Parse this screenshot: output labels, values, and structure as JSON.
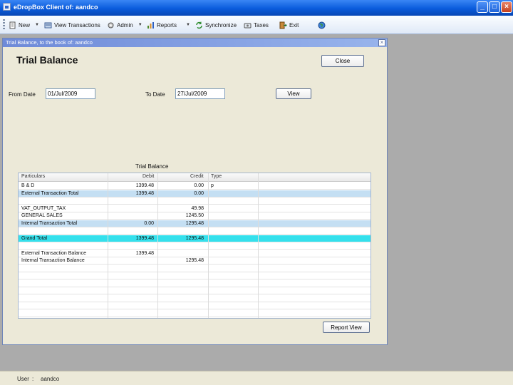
{
  "app": {
    "title": "eDropBox Client of: aandco",
    "minimize": "_",
    "maximize": "□",
    "close": "×"
  },
  "toolbar": {
    "items": [
      {
        "label": "New",
        "icon": "new-icon"
      },
      {
        "label": "View Transactions",
        "icon": "view-transactions-icon"
      },
      {
        "label": "Admin",
        "icon": "admin-icon"
      },
      {
        "label": "Reports",
        "icon": "reports-icon"
      },
      {
        "label": "Synchronize",
        "icon": "synchronize-icon"
      },
      {
        "label": "Taxes",
        "icon": "taxes-icon"
      },
      {
        "label": "Exit",
        "icon": "exit-icon"
      }
    ],
    "dropdown_glyph": "▼"
  },
  "window": {
    "title": "Trial Balance, to the book of: aandco",
    "close_glyph": "×"
  },
  "page": {
    "title": "Trial Balance",
    "close_button": "Close",
    "from_label": "From Date",
    "from_value": "01/Jul/2009",
    "to_label": "To Date",
    "to_value": "27/Jul/2009",
    "view_button": "View",
    "report_title": "Trial Balance",
    "report_view_button": "Report View"
  },
  "grid": {
    "columns": [
      "Particulars",
      "Debit",
      "Credit",
      "Type"
    ],
    "rows": [
      {
        "particulars": "B & D",
        "debit": "1399.48",
        "credit": "0.00",
        "type": "p",
        "style": ""
      },
      {
        "particulars": "External Transaction Total",
        "debit": "1399.48",
        "credit": "0.00",
        "type": "",
        "style": "hl"
      },
      {
        "particulars": "",
        "debit": "",
        "credit": "",
        "type": "",
        "style": ""
      },
      {
        "particulars": "VAT_OUTPUT_TAX",
        "debit": "",
        "credit": "49.98",
        "type": "",
        "style": ""
      },
      {
        "particulars": "GENERAL SALES",
        "debit": "",
        "credit": "1245.50",
        "type": "",
        "style": ""
      },
      {
        "particulars": "Internal Transaction Total",
        "debit": "0.00",
        "credit": "1295.48",
        "type": "",
        "style": "hl"
      },
      {
        "particulars": "",
        "debit": "",
        "credit": "",
        "type": "",
        "style": ""
      },
      {
        "particulars": "Grand Total",
        "debit": "1399.48",
        "credit": "1295.48",
        "type": "",
        "style": "tot"
      },
      {
        "particulars": "",
        "debit": "",
        "credit": "",
        "type": "",
        "style": ""
      },
      {
        "particulars": "External Transaction Balance",
        "debit": "1399.48",
        "credit": "",
        "type": "",
        "style": ""
      },
      {
        "particulars": "Internal Transaction Balance",
        "debit": "",
        "credit": "1295.48",
        "type": "",
        "style": ""
      }
    ],
    "empty_rows": 7
  },
  "status": {
    "user_label": "User",
    "separator": ":",
    "user_value": "aandco"
  }
}
